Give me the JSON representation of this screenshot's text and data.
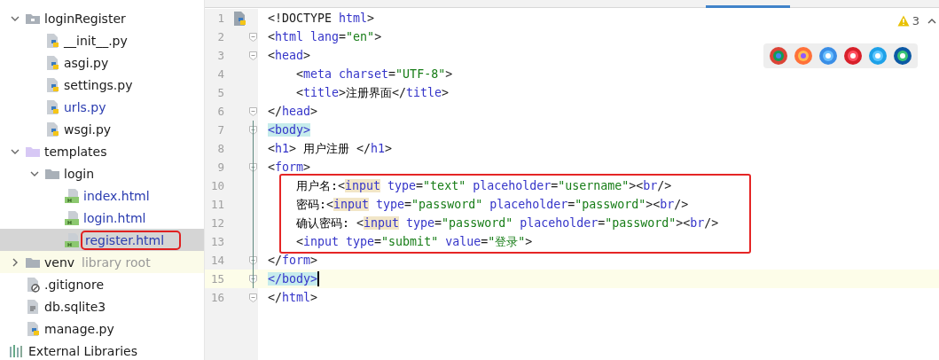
{
  "project_tree": [
    {
      "name": "loginRegister",
      "kind": "package",
      "expanded": true,
      "selected": false,
      "modified": false,
      "children": [
        {
          "name": "__init__.py",
          "kind": "python",
          "selected": false,
          "modified": false
        },
        {
          "name": "asgi.py",
          "kind": "python",
          "selected": false,
          "modified": false
        },
        {
          "name": "settings.py",
          "kind": "python",
          "selected": false,
          "modified": false
        },
        {
          "name": "urls.py",
          "kind": "python",
          "selected": false,
          "modified": true
        },
        {
          "name": "wsgi.py",
          "kind": "python",
          "selected": false,
          "modified": false
        }
      ]
    },
    {
      "name": "templates",
      "kind": "templates",
      "expanded": true,
      "selected": false,
      "modified": false,
      "children": [
        {
          "name": "login",
          "kind": "folder",
          "expanded": true,
          "selected": false,
          "modified": false,
          "children": [
            {
              "name": "index.html",
              "kind": "html",
              "selected": false,
              "modified": true
            },
            {
              "name": "login.html",
              "kind": "html",
              "selected": false,
              "modified": true
            },
            {
              "name": "register.html",
              "kind": "html",
              "selected": true,
              "modified": true,
              "outlined": true
            }
          ]
        }
      ]
    },
    {
      "name": "venv",
      "note": "library root",
      "kind": "folder",
      "expanded": false,
      "selected": false,
      "modified": false
    },
    {
      "name": ".gitignore",
      "kind": "ignored",
      "selected": false,
      "modified": false
    },
    {
      "name": "db.sqlite3",
      "kind": "text",
      "selected": false,
      "modified": false
    },
    {
      "name": "manage.py",
      "kind": "python",
      "selected": false,
      "modified": false
    },
    {
      "name": "External Libraries",
      "kind": "library",
      "selected": false,
      "modified": false
    }
  ],
  "editor": {
    "inspection": {
      "count": "3"
    },
    "lines": [
      {
        "number": "1",
        "fold": false,
        "tokens": [
          {
            "kind": "punct",
            "text": "<!DOCTYPE"
          },
          {
            "kind": "tag",
            "text": " html"
          },
          {
            "kind": "punct",
            "text": ">"
          }
        ]
      },
      {
        "number": "2",
        "fold": true,
        "tokens": [
          {
            "kind": "punct",
            "text": "<"
          },
          {
            "kind": "tag",
            "text": "html"
          },
          {
            "kind": "attr",
            "text": " lang"
          },
          {
            "kind": "punct",
            "text": "="
          },
          {
            "kind": "string",
            "text": "\"en\""
          },
          {
            "kind": "punct",
            "text": ">"
          }
        ]
      },
      {
        "number": "3",
        "fold": true,
        "tokens": [
          {
            "kind": "punct",
            "text": "<"
          },
          {
            "kind": "tag",
            "text": "head"
          },
          {
            "kind": "punct",
            "text": ">"
          }
        ]
      },
      {
        "number": "4",
        "fold": false,
        "indented": true,
        "tokens": [
          {
            "kind": "punct",
            "text": "<"
          },
          {
            "kind": "tag",
            "text": "meta"
          },
          {
            "kind": "attr",
            "text": " charset"
          },
          {
            "kind": "punct",
            "text": "="
          },
          {
            "kind": "string",
            "text": "\"UTF-8\""
          },
          {
            "kind": "punct",
            "text": ">"
          }
        ]
      },
      {
        "number": "5",
        "fold": false,
        "indented": true,
        "tokens": [
          {
            "kind": "punct",
            "text": "<"
          },
          {
            "kind": "tag",
            "text": "title"
          },
          {
            "kind": "punct",
            "text": ">"
          },
          {
            "kind": "text",
            "text": "注册界面"
          },
          {
            "kind": "punct",
            "text": "</"
          },
          {
            "kind": "tag",
            "text": "title"
          },
          {
            "kind": "punct",
            "text": ">"
          }
        ]
      },
      {
        "number": "6",
        "fold": true,
        "tokens": [
          {
            "kind": "punct",
            "text": "</"
          },
          {
            "kind": "tag",
            "text": "head"
          },
          {
            "kind": "punct",
            "text": ">"
          }
        ]
      },
      {
        "number": "7",
        "fold": true,
        "tokens": [
          {
            "kind": "match",
            "text": "<body>"
          }
        ]
      },
      {
        "number": "8",
        "fold": false,
        "tokens": [
          {
            "kind": "punct",
            "text": "<"
          },
          {
            "kind": "tag",
            "text": "h1"
          },
          {
            "kind": "punct",
            "text": ">"
          },
          {
            "kind": "text",
            "text": " 用户注册 "
          },
          {
            "kind": "punct",
            "text": "</"
          },
          {
            "kind": "tag",
            "text": "h1"
          },
          {
            "kind": "punct",
            "text": ">"
          }
        ]
      },
      {
        "number": "9",
        "fold": true,
        "tokens": [
          {
            "kind": "punct",
            "text": "<"
          },
          {
            "kind": "tag",
            "text": "form"
          },
          {
            "kind": "punct",
            "text": ">"
          }
        ]
      },
      {
        "number": "10",
        "fold": false,
        "indented": true,
        "outlined": true,
        "tokens": [
          {
            "kind": "text",
            "text": "用户名:"
          },
          {
            "kind": "punct",
            "text": "<"
          },
          {
            "kind": "usage",
            "text": "input"
          },
          {
            "kind": "attr",
            "text": " type"
          },
          {
            "kind": "punct",
            "text": "="
          },
          {
            "kind": "string",
            "text": "\"text\""
          },
          {
            "kind": "attr",
            "text": " placeholder"
          },
          {
            "kind": "punct",
            "text": "="
          },
          {
            "kind": "string",
            "text": "\"username\""
          },
          {
            "kind": "punct",
            "text": "><"
          },
          {
            "kind": "tag",
            "text": "br"
          },
          {
            "kind": "punct",
            "text": "/>"
          }
        ]
      },
      {
        "number": "11",
        "fold": false,
        "indented": true,
        "outlined": true,
        "tokens": [
          {
            "kind": "text",
            "text": "密码:"
          },
          {
            "kind": "punct",
            "text": "<"
          },
          {
            "kind": "usage",
            "text": "input"
          },
          {
            "kind": "attr",
            "text": " type"
          },
          {
            "kind": "punct",
            "text": "="
          },
          {
            "kind": "string",
            "text": "\"password\""
          },
          {
            "kind": "attr",
            "text": " placeholder"
          },
          {
            "kind": "punct",
            "text": "="
          },
          {
            "kind": "string",
            "text": "\"password\""
          },
          {
            "kind": "punct",
            "text": "><"
          },
          {
            "kind": "tag",
            "text": "br"
          },
          {
            "kind": "punct",
            "text": "/>"
          }
        ]
      },
      {
        "number": "12",
        "fold": false,
        "indented": true,
        "outlined": true,
        "tokens": [
          {
            "kind": "text",
            "text": "确认密码: "
          },
          {
            "kind": "punct",
            "text": "<"
          },
          {
            "kind": "usage",
            "text": "input"
          },
          {
            "kind": "attr",
            "text": " type"
          },
          {
            "kind": "punct",
            "text": "="
          },
          {
            "kind": "string",
            "text": "\"password\""
          },
          {
            "kind": "attr",
            "text": " placeholder"
          },
          {
            "kind": "punct",
            "text": "="
          },
          {
            "kind": "string",
            "text": "\"password\""
          },
          {
            "kind": "punct",
            "text": "><"
          },
          {
            "kind": "tag",
            "text": "br"
          },
          {
            "kind": "punct",
            "text": "/>"
          }
        ]
      },
      {
        "number": "13",
        "fold": false,
        "indented": true,
        "outlined": true,
        "tokens": [
          {
            "kind": "punct",
            "text": "<"
          },
          {
            "kind": "tag",
            "text": "input"
          },
          {
            "kind": "attr",
            "text": " type"
          },
          {
            "kind": "punct",
            "text": "="
          },
          {
            "kind": "string",
            "text": "\"submit\""
          },
          {
            "kind": "attr",
            "text": " value"
          },
          {
            "kind": "punct",
            "text": "="
          },
          {
            "kind": "string",
            "text": "\"登录\""
          },
          {
            "kind": "punct",
            "text": ">"
          }
        ]
      },
      {
        "number": "14",
        "fold": true,
        "tokens": [
          {
            "kind": "punct",
            "text": "</"
          },
          {
            "kind": "tag",
            "text": "form"
          },
          {
            "kind": "punct",
            "text": ">"
          }
        ]
      },
      {
        "number": "15",
        "fold": true,
        "current": true,
        "tokens": [
          {
            "kind": "match",
            "text": "</body>"
          }
        ]
      },
      {
        "number": "16",
        "fold": true,
        "tokens": [
          {
            "kind": "punct",
            "text": "</"
          },
          {
            "kind": "tag",
            "text": "html"
          },
          {
            "kind": "punct",
            "text": ">"
          }
        ]
      }
    ]
  }
}
